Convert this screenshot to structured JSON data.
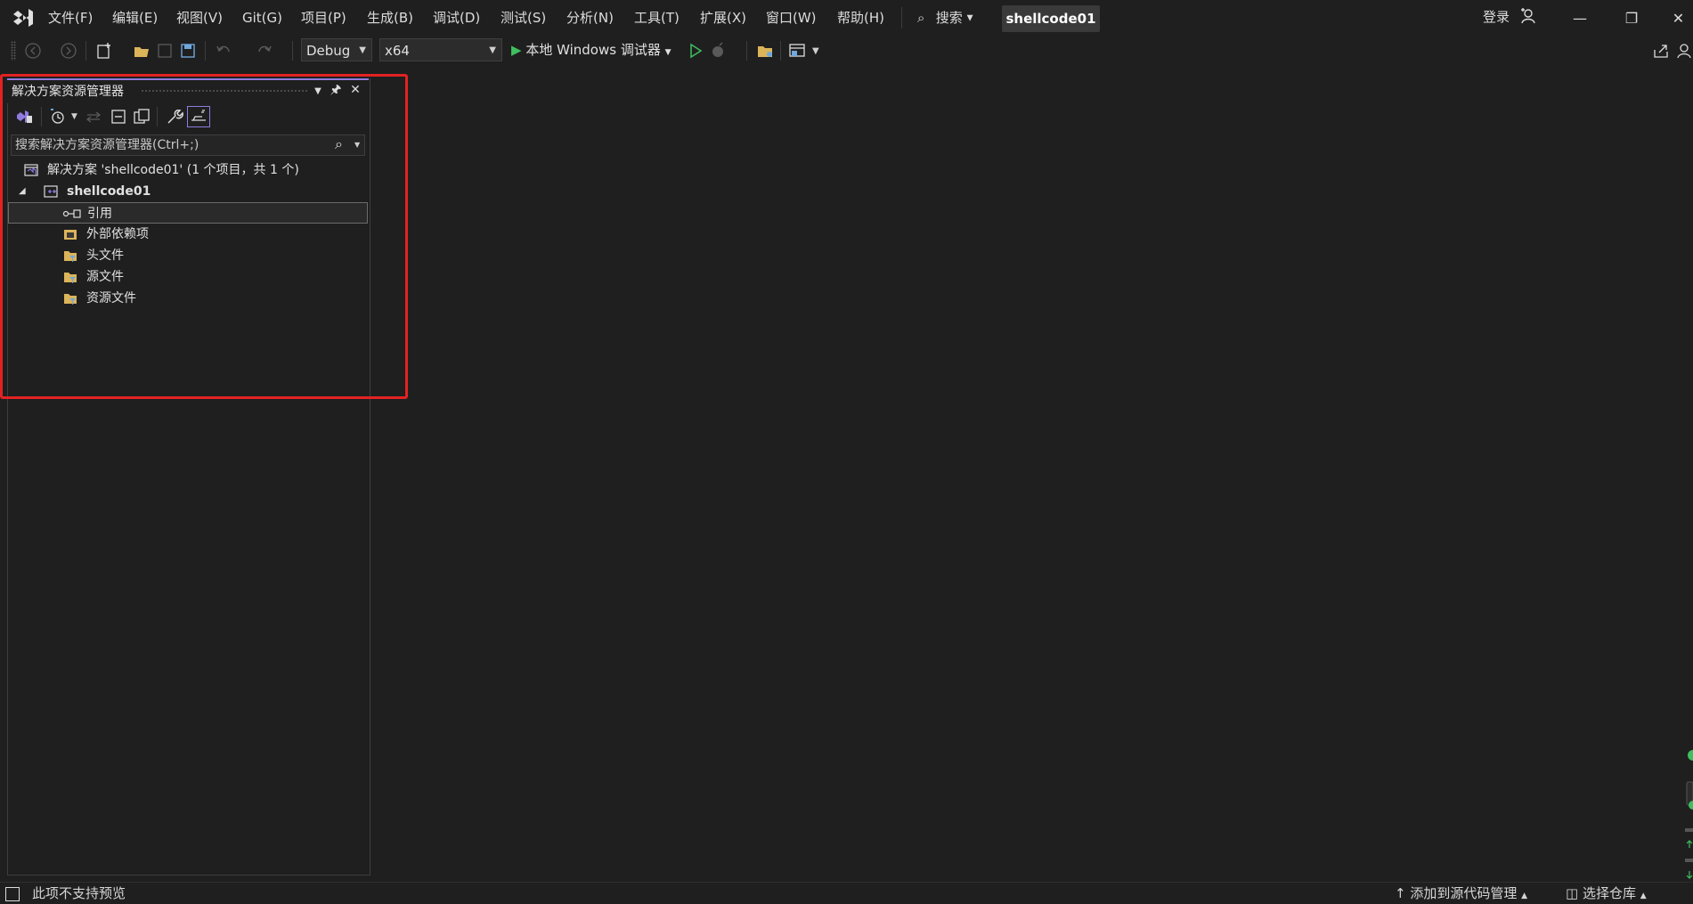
{
  "menu": {
    "items": [
      "文件(F)",
      "编辑(E)",
      "视图(V)",
      "Git(G)",
      "项目(P)",
      "生成(B)",
      "调试(D)",
      "测试(S)",
      "分析(N)",
      "工具(T)",
      "扩展(X)",
      "窗口(W)",
      "帮助(H)"
    ],
    "search_label": "搜索",
    "solution_name": "shellcode01",
    "login_label": "登录"
  },
  "toolbar": {
    "config": "Debug",
    "platform": "x64",
    "run_target": "本地 Windows 调试器"
  },
  "solution_explorer": {
    "title": "解决方案资源管理器",
    "search_placeholder": "搜索解决方案资源管理器(Ctrl+;)",
    "tree": {
      "solution": "解决方案 'shellcode01' (1 个项目，共 1 个)",
      "project": "shellcode01",
      "children": [
        "引用",
        "外部依赖项",
        "头文件",
        "源文件",
        "资源文件"
      ]
    }
  },
  "statusbar": {
    "left": "此项不支持预览",
    "source_control": "添加到源代码管理",
    "repo": "选择仓库"
  },
  "colors": {
    "background": "#1f1f1f",
    "accent": "#8f7be0",
    "highlight_outline": "#e32222",
    "run_green": "#3fbf5f"
  }
}
